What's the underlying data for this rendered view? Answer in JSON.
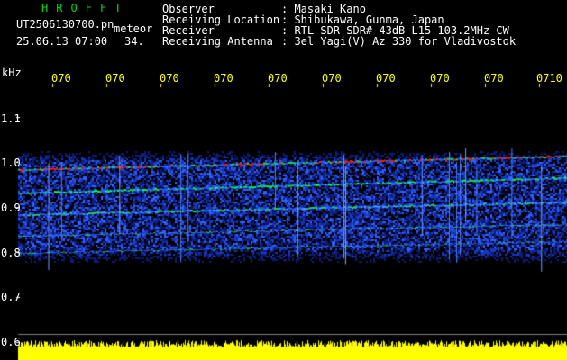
{
  "header": {
    "title": "HROFFT",
    "filename": "UT2506130700.pn",
    "type_label": "meteor",
    "datetime": "25.06.13 07:00",
    "count": "34.",
    "fields": [
      {
        "label": "Observer",
        "value": ": Masaki Kano"
      },
      {
        "label": "Receiving Location",
        "value": ": Shibukawa, Gunma, Japan"
      },
      {
        "label": "Receiver",
        "value": ": RTL-SDR SDR# 43dB L15 103.2MHz CW"
      },
      {
        "label": "Receiving Antenna",
        "value": ": 3el Yagi(V) Az 330 for Vladivostok"
      }
    ]
  },
  "axis": {
    "unit": "kHz",
    "y_ticks": [
      "1.1",
      "1.0",
      "0.9",
      "0.8",
      "0.7",
      "0.6"
    ],
    "x_ticks": [
      "070",
      "070",
      "070",
      "070",
      "070",
      "070",
      "070",
      "070",
      "070",
      "0710"
    ]
  },
  "colors": {
    "background": "#000000",
    "title": "#00d800",
    "text": "#ffffff",
    "ticks": "#ffff00",
    "signal_high": "#ff2000",
    "signal_mid": "#00ff60",
    "signal_low": "#1040ff",
    "noise_bar": "#ffff00"
  }
}
